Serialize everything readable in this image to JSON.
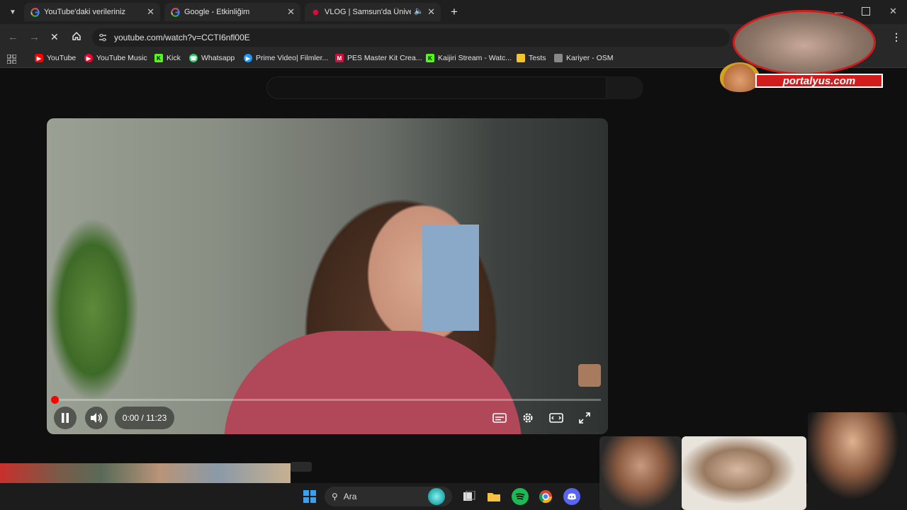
{
  "browser": {
    "tabs": [
      {
        "title": "YouTube'daki verileriniz",
        "icon": "google-icon"
      },
      {
        "title": "Google - Etkinliğim",
        "icon": "google-icon"
      },
      {
        "title": "VLOG | Samsun'da Üniversit",
        "icon": "youtube-icon",
        "active": true
      }
    ],
    "new_tab": "+",
    "close_tab": "✕",
    "address": "youtube.com/watch?v=CCTI6nfl00E",
    "bookmarks": [
      {
        "label": "YouTube",
        "icon": "youtube-icon",
        "color": "#ff0000"
      },
      {
        "label": "YouTube Music",
        "icon": "youtube-music-icon",
        "color": "#ff0033"
      },
      {
        "label": "Kick",
        "icon": "kick-icon",
        "color": "#53fc18"
      },
      {
        "label": "Whatsapp",
        "icon": "whatsapp-icon",
        "color": "#25d366"
      },
      {
        "label": "Prime Video| Filmler...",
        "icon": "prime-video-icon",
        "color": "#1a98ff"
      },
      {
        "label": "PES Master Kit Crea...",
        "icon": "pes-master-icon",
        "color": "#d0103a"
      },
      {
        "label": "Kaijiri Stream - Watc...",
        "icon": "kick-icon",
        "color": "#53fc18"
      },
      {
        "label": "Tests",
        "icon": "tests-icon",
        "color": "#f4c430"
      },
      {
        "label": "Kariyer - OSM",
        "icon": "kariyer-icon",
        "color": "#888888"
      }
    ]
  },
  "player": {
    "time": "0:00 / 11:23",
    "progress": 0.0
  },
  "overlay": {
    "brand": "portalyus.com"
  },
  "taskbar": {
    "search_label": "Ara"
  }
}
